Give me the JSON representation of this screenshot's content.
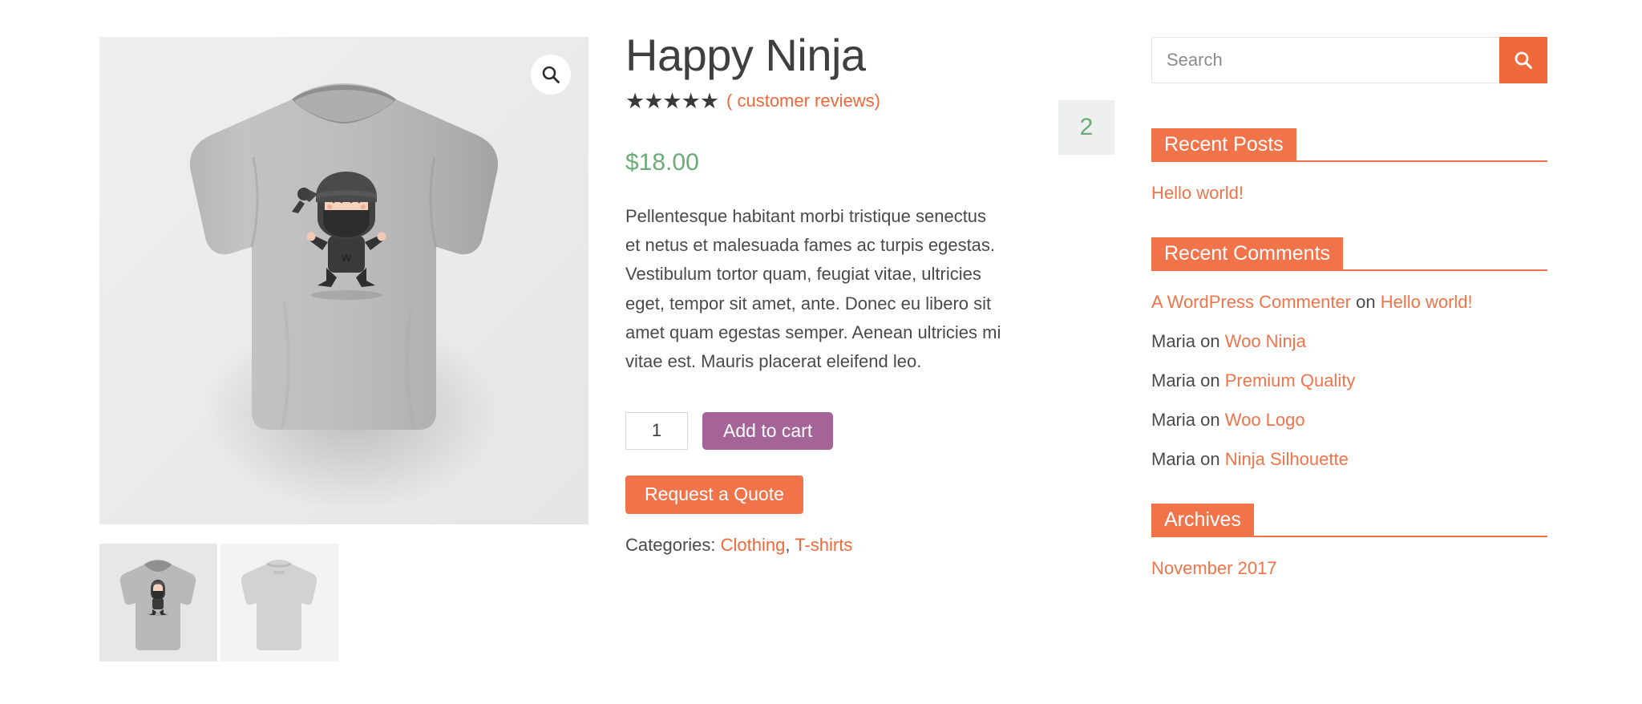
{
  "product": {
    "title": "Happy Ninja",
    "rating_stars": "★★★★★",
    "rating_value": 5,
    "review_link_text": "( customer reviews)",
    "review_count_badge": "2",
    "price": "$18.00",
    "description": "Pellentesque habitant morbi tristique senectus et netus et malesuada fames ac turpis egestas. Vestibulum tortor quam, feugiat vitae, ultricies eget, tempor sit amet, ante. Donec eu libero sit amet quam egestas semper. Aenean ultricies mi vitae est. Mauris placerat eleifend leo.",
    "quantity_value": "1",
    "add_to_cart_label": "Add to cart",
    "request_quote_label": "Request a Quote",
    "categories_label": "Categories:",
    "categories": [
      "Clothing",
      "T-shirts"
    ],
    "categories_separator": ", ",
    "zoom_icon": "search-icon",
    "gallery": {
      "main_alt": "Happy Ninja grey t-shirt front view",
      "thumbnails": [
        {
          "alt": "Happy Ninja t-shirt front",
          "view": "front"
        },
        {
          "alt": "Happy Ninja t-shirt back",
          "view": "back"
        }
      ]
    }
  },
  "sidebar": {
    "search": {
      "placeholder": "Search",
      "value": "",
      "button_icon": "search-icon"
    },
    "widgets": [
      {
        "title": "Recent Posts",
        "type": "links",
        "items": [
          {
            "text": "Hello world!"
          }
        ]
      },
      {
        "title": "Recent Comments",
        "type": "comments",
        "items": [
          {
            "author": "A WordPress Commenter",
            "author_is_link": true,
            "on": " on ",
            "post": "Hello world!"
          },
          {
            "author": "Maria",
            "author_is_link": false,
            "on": " on ",
            "post": "Woo Ninja"
          },
          {
            "author": "Maria",
            "author_is_link": false,
            "on": " on ",
            "post": "Premium Quality"
          },
          {
            "author": "Maria",
            "author_is_link": false,
            "on": " on ",
            "post": "Woo Logo"
          },
          {
            "author": "Maria",
            "author_is_link": false,
            "on": " on ",
            "post": "Ninja Silhouette"
          }
        ]
      },
      {
        "title": "Archives",
        "type": "links",
        "items": [
          {
            "text": "November 2017"
          }
        ]
      }
    ]
  },
  "colors": {
    "accent_orange": "#f1734a",
    "link_orange": "#f1683a",
    "price_green": "#6cab78",
    "add_to_cart_purple": "#a46497",
    "image_bg": "#ececec",
    "badge_bg": "#eeefef",
    "text": "#4a4a4a"
  }
}
